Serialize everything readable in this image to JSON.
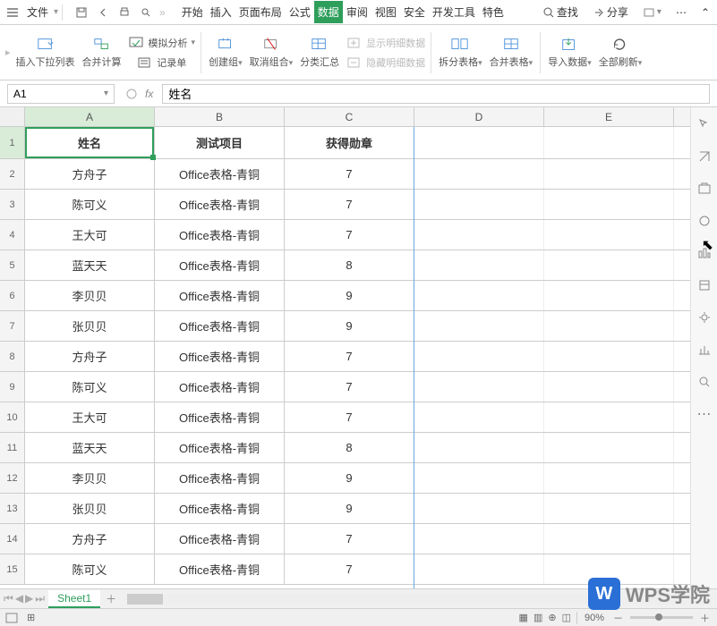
{
  "menubar": {
    "file_label": "文件",
    "tabs": [
      "开始",
      "插入",
      "页面布局",
      "公式",
      "数据",
      "审阅",
      "视图",
      "安全",
      "开发工具",
      "特色"
    ],
    "active_tab_index": 4,
    "search_label": "查找",
    "share_label": "分享"
  },
  "ribbon": {
    "dropdown_label": "插入下拉列表",
    "consolidate_label": "合并计算",
    "scenario_label": "模拟分析",
    "record_label": "记录单",
    "group_label": "创建组",
    "ungroup_label": "取消组合",
    "subtotal_label": "分类汇总",
    "show_detail_label": "显示明细数据",
    "hide_detail_label": "隐藏明细数据",
    "split_table_label": "拆分表格",
    "merge_table_label": "合并表格",
    "import_label": "导入数据",
    "refresh_label": "全部刷新"
  },
  "formula_bar": {
    "name_box": "A1",
    "fx": "fx",
    "value": "姓名"
  },
  "columns": [
    "A",
    "B",
    "C",
    "D",
    "E"
  ],
  "sheet": {
    "headers": [
      "姓名",
      "测试项目",
      "获得勋章"
    ],
    "rows": [
      {
        "n": "方舟子",
        "p": "Office表格-青铜",
        "b": "7"
      },
      {
        "n": "陈可义",
        "p": "Office表格-青铜",
        "b": "7"
      },
      {
        "n": "王大可",
        "p": "Office表格-青铜",
        "b": "7"
      },
      {
        "n": "蓝天天",
        "p": "Office表格-青铜",
        "b": "8"
      },
      {
        "n": "李贝贝",
        "p": "Office表格-青铜",
        "b": "9"
      },
      {
        "n": "张贝贝",
        "p": "Office表格-青铜",
        "b": "9"
      },
      {
        "n": "方舟子",
        "p": "Office表格-青铜",
        "b": "7"
      },
      {
        "n": "陈可义",
        "p": "Office表格-青铜",
        "b": "7"
      },
      {
        "n": "王大可",
        "p": "Office表格-青铜",
        "b": "7"
      },
      {
        "n": "蓝天天",
        "p": "Office表格-青铜",
        "b": "8"
      },
      {
        "n": "李贝贝",
        "p": "Office表格-青铜",
        "b": "9"
      },
      {
        "n": "张贝贝",
        "p": "Office表格-青铜",
        "b": "9"
      },
      {
        "n": "方舟子",
        "p": "Office表格-青铜",
        "b": "7"
      },
      {
        "n": "陈可义",
        "p": "Office表格-青铜",
        "b": "7"
      }
    ]
  },
  "tabs": {
    "sheet1": "Sheet1"
  },
  "status": {
    "zoom": "90%"
  },
  "watermark": {
    "logo": "W",
    "text": "WPS学院"
  }
}
